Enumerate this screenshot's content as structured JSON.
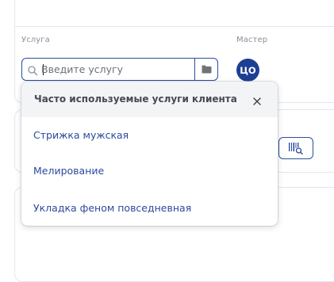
{
  "form": {
    "service_label": "Услуга",
    "master_label": "Мастер",
    "service_placeholder": "Введите услугу",
    "master_initials": "ЦО"
  },
  "dropdown": {
    "title": "Часто используемые услуги клиента",
    "items": [
      {
        "label": "Стрижка мужская"
      },
      {
        "label": "Мелирование"
      },
      {
        "label": "Укладка феном повседневная"
      }
    ]
  },
  "icons": {
    "search": "search-icon",
    "folder": "folder-icon",
    "close": "close-icon",
    "barcode": "barcode-scan-icon"
  },
  "colors": {
    "accent": "#2d4d9c",
    "avatar": "#1d3f93",
    "link": "#2a4a9c",
    "header_bg": "#f3f4f6"
  }
}
